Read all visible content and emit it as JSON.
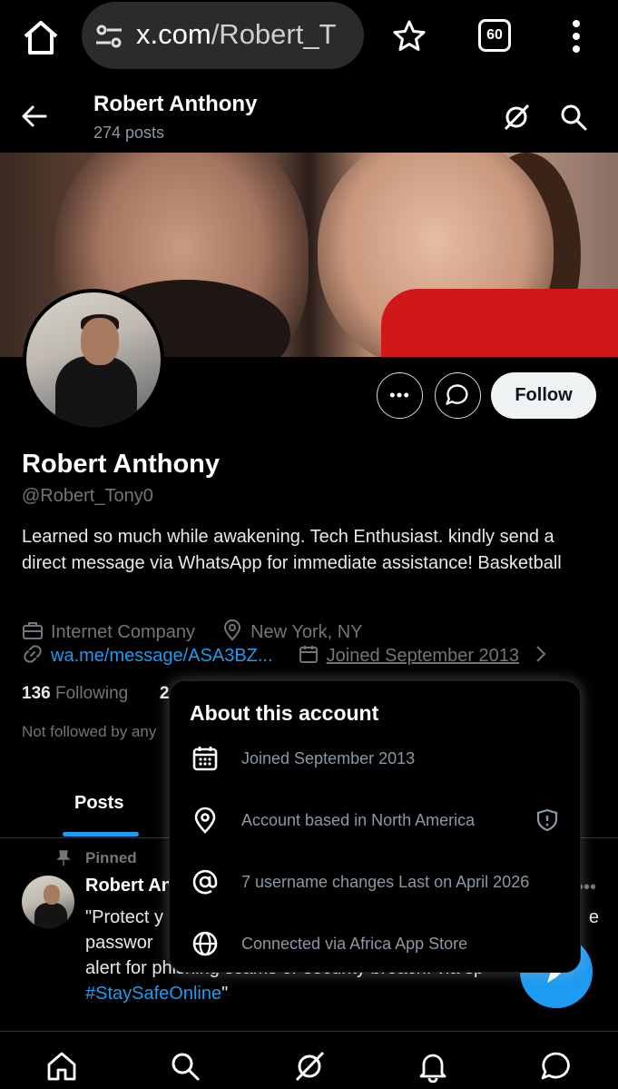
{
  "browser": {
    "url_host": "x.com",
    "url_path": "/Robert_T",
    "tab_count": "60"
  },
  "header": {
    "name": "Robert Anthony",
    "posts_count": "274 posts"
  },
  "actions": {
    "follow_label": "Follow"
  },
  "profile": {
    "name": "Robert Anthony",
    "handle": "@Robert_Tony0",
    "bio": "Learned so much while awakening. Tech Enthusiast. kindly send a direct message via WhatsApp for immediate assistance! Basketball",
    "category": "Internet Company",
    "location": "New York, NY",
    "link": "wa.me/message/ASA3BZ...",
    "joined": "Joined September 2013",
    "following_count": "136",
    "following_label": " Following",
    "followers_partial": "2",
    "not_followed": "Not followed by any"
  },
  "tabs": {
    "posts": "Posts"
  },
  "pinned_post": {
    "pinned_label": "Pinned",
    "author": "Robert An",
    "text_line1": "\"Protect y",
    "text_line1_tail": "e",
    "text_line2": "passwor",
    "text_line3": "alert for phishing scams or security breach. via sp",
    "hashtag": "#StaySafeOnline",
    "text_end": "\""
  },
  "about_popup": {
    "title": "About this account",
    "rows": [
      {
        "icon": "calendar-icon",
        "text": "Joined September 2013"
      },
      {
        "icon": "location-pin-icon",
        "text": "Account based in North America"
      },
      {
        "icon": "at-sign-icon",
        "text": "7 username changes Last on April 2026"
      },
      {
        "icon": "globe-icon",
        "text": "Connected via Africa App Store"
      }
    ]
  },
  "colors": {
    "accent": "#1d9bf0",
    "background": "#000000",
    "muted_text": "#71767b"
  }
}
